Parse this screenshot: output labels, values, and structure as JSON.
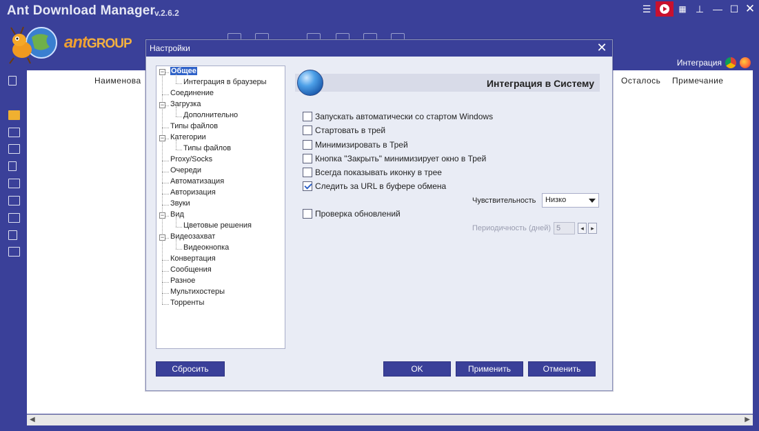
{
  "app": {
    "title": "Ant Download Manager",
    "version": "v.2.6.2"
  },
  "window_controls": [
    "menu-icon",
    "play-icon",
    "grid-icon",
    "pin-icon",
    "minimize-icon",
    "maximize-icon",
    "close-icon"
  ],
  "integration": {
    "label": "Интеграция"
  },
  "logo": {
    "brand_main": "ant",
    "brand_sub": "GROUP"
  },
  "grid": {
    "columns": [
      "Наименова",
      "Осталось",
      "Примечание"
    ]
  },
  "dialog": {
    "title": "Настройки",
    "section_title": "Интеграция в Систему",
    "tree": [
      {
        "label": "Общее",
        "level": 0,
        "expandable": true,
        "selected": true
      },
      {
        "label": "Интеграция в браузеры",
        "level": 1
      },
      {
        "label": "Соединение",
        "level": 0
      },
      {
        "label": "Загрузка",
        "level": 0,
        "expandable": true
      },
      {
        "label": "Дополнительно",
        "level": 1
      },
      {
        "label": "Типы файлов",
        "level": 0
      },
      {
        "label": "Категории",
        "level": 0,
        "expandable": true
      },
      {
        "label": "Типы файлов",
        "level": 1
      },
      {
        "label": "Proxy/Socks",
        "level": 0
      },
      {
        "label": "Очереди",
        "level": 0
      },
      {
        "label": "Автоматизация",
        "level": 0
      },
      {
        "label": "Авторизация",
        "level": 0
      },
      {
        "label": "Звуки",
        "level": 0
      },
      {
        "label": "Вид",
        "level": 0,
        "expandable": true
      },
      {
        "label": "Цветовые решения",
        "level": 1
      },
      {
        "label": "Видеозахват",
        "level": 0,
        "expandable": true
      },
      {
        "label": "Видеокнопка",
        "level": 1
      },
      {
        "label": "Конвертация",
        "level": 0
      },
      {
        "label": "Сообщения",
        "level": 0
      },
      {
        "label": "Разное",
        "level": 0
      },
      {
        "label": "Мультихостеры",
        "level": 0
      },
      {
        "label": "Торренты",
        "level": 0
      }
    ],
    "options": [
      {
        "label": "Запускать автоматически со стартом Windows",
        "checked": false
      },
      {
        "label": "Стартовать в трей",
        "checked": false
      },
      {
        "label": "Минимизировать в Трей",
        "checked": false
      },
      {
        "label": "Кнопка \"Закрыть\" минимизирует окно в Трей",
        "checked": false
      },
      {
        "label": "Всегда показывать иконку в трее",
        "checked": false
      },
      {
        "label": "Следить за URL в буфере обмена",
        "checked": true
      },
      {
        "label": "Проверка обновлений",
        "checked": false
      }
    ],
    "sensitivity": {
      "label": "Чувствительность",
      "value": "Низко"
    },
    "period": {
      "label": "Периодичность (дней)",
      "value": "5"
    },
    "buttons": {
      "reset": "Сбросить",
      "ok": "OK",
      "apply": "Применить",
      "cancel": "Отменить"
    }
  },
  "colors": {
    "frame": "#3a4099",
    "selection": "#2f62c8",
    "close_active": "#c8102e"
  }
}
